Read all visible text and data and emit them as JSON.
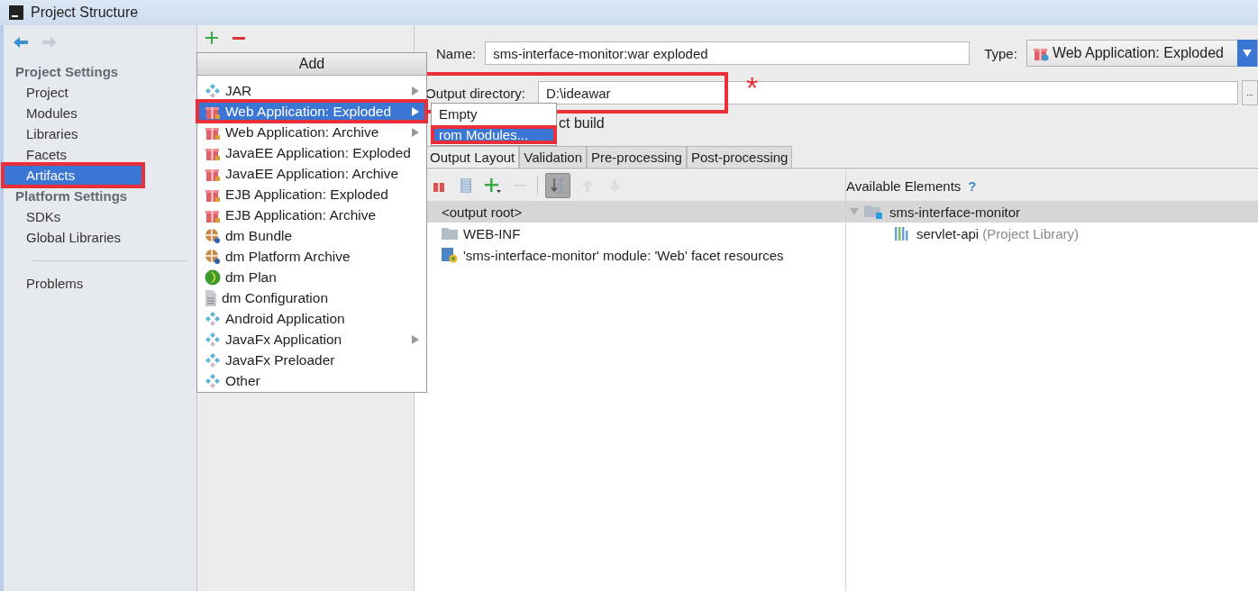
{
  "window": {
    "title": "Project Structure"
  },
  "sidebar": {
    "sections": [
      {
        "heading": "Project Settings",
        "items": [
          {
            "label": "Project",
            "selected": false,
            "highlighted": false
          },
          {
            "label": "Modules",
            "selected": false,
            "highlighted": false
          },
          {
            "label": "Libraries",
            "selected": false,
            "highlighted": false
          },
          {
            "label": "Facets",
            "selected": false,
            "highlighted": false
          },
          {
            "label": "Artifacts",
            "selected": true,
            "highlighted": true
          }
        ]
      },
      {
        "heading": "Platform Settings",
        "items": [
          {
            "label": "SDKs",
            "selected": false,
            "highlighted": false
          },
          {
            "label": "Global Libraries",
            "selected": false,
            "highlighted": false
          }
        ]
      }
    ],
    "footer_items": [
      {
        "label": "Problems",
        "selected": false,
        "highlighted": false
      }
    ]
  },
  "add_menu": {
    "title": "Add",
    "items": [
      {
        "label": "JAR",
        "kind": "diamond",
        "has_submenu": true,
        "selected": false,
        "highlighted": false
      },
      {
        "label": "Web Application: Exploded",
        "kind": "gift",
        "has_submenu": true,
        "selected": true,
        "highlighted": true
      },
      {
        "label": "Web Application: Archive",
        "kind": "gift",
        "has_submenu": true,
        "selected": false,
        "highlighted": false
      },
      {
        "label": "JavaEE Application: Exploded",
        "kind": "gift",
        "has_submenu": false,
        "selected": false,
        "highlighted": false
      },
      {
        "label": "JavaEE Application: Archive",
        "kind": "gift",
        "has_submenu": false,
        "selected": false,
        "highlighted": false
      },
      {
        "label": "EJB Application: Exploded",
        "kind": "gift",
        "has_submenu": false,
        "selected": false,
        "highlighted": false
      },
      {
        "label": "EJB Application: Archive",
        "kind": "gift",
        "has_submenu": false,
        "selected": false,
        "highlighted": false
      },
      {
        "label": "dm Bundle",
        "kind": "bundle",
        "has_submenu": false,
        "selected": false,
        "highlighted": false
      },
      {
        "label": "dm Platform Archive",
        "kind": "bundle",
        "has_submenu": false,
        "selected": false,
        "highlighted": false
      },
      {
        "label": "dm Plan",
        "kind": "plan",
        "has_submenu": false,
        "selected": false,
        "highlighted": false
      },
      {
        "label": "dm Configuration",
        "kind": "document",
        "has_submenu": false,
        "selected": false,
        "highlighted": false
      },
      {
        "label": "Android Application",
        "kind": "diamond",
        "has_submenu": false,
        "selected": false,
        "highlighted": false
      },
      {
        "label": "JavaFx Application",
        "kind": "diamond",
        "has_submenu": true,
        "selected": false,
        "highlighted": false
      },
      {
        "label": "JavaFx Preloader",
        "kind": "diamond",
        "has_submenu": false,
        "selected": false,
        "highlighted": false
      },
      {
        "label": "Other",
        "kind": "diamond",
        "has_submenu": false,
        "selected": false,
        "highlighted": false
      }
    ]
  },
  "submenu": {
    "items": [
      {
        "label": "Empty",
        "selected": false,
        "highlighted": false
      },
      {
        "label": "rom Modules...",
        "selected": true,
        "highlighted": true
      }
    ]
  },
  "artifact": {
    "name_label": "Name:",
    "name": "sms-interface-monitor:war exploded",
    "type_label": "Type:",
    "type": "Web Application: Exploded",
    "output_label": "Output directory:",
    "output_dir": "D:\\ideawar",
    "output_highlighted": true,
    "browse": "...",
    "build_label": "ct build",
    "annotation_mark": "*"
  },
  "tabs": [
    {
      "label": "Output Layout",
      "selected": true
    },
    {
      "label": "Validation",
      "selected": false
    },
    {
      "label": "Pre-processing",
      "selected": false
    },
    {
      "label": "Post-processing",
      "selected": false
    }
  ],
  "layout_toolbar": [
    {
      "kind": "artifact",
      "disabled": false,
      "pressed": false
    },
    {
      "kind": "library",
      "disabled": false,
      "pressed": false
    },
    {
      "kind": "add",
      "disabled": false,
      "pressed": false
    },
    {
      "kind": "remove",
      "disabled": true,
      "pressed": false
    },
    {
      "kind": "sort",
      "disabled": false,
      "pressed": true
    },
    {
      "kind": "up",
      "disabled": true,
      "pressed": false
    },
    {
      "kind": "down",
      "disabled": true,
      "pressed": false
    }
  ],
  "layout_tree": [
    {
      "label": "<output root>",
      "selected": true,
      "children": [
        {
          "label": "WEB-INF",
          "kind": "folder",
          "selected": false
        },
        {
          "label": "'sms-interface-monitor' module: 'Web' facet resources",
          "kind": "facet",
          "selected": false
        }
      ]
    }
  ],
  "available": {
    "title": "Available Elements",
    "help": "?",
    "tree": [
      {
        "label": "sms-interface-monitor",
        "kind": "module",
        "expanded": true,
        "selected": true,
        "children": [
          {
            "label": "servlet-api",
            "note": "(Project Library)",
            "kind": "library",
            "selected": false
          }
        ]
      }
    ]
  }
}
